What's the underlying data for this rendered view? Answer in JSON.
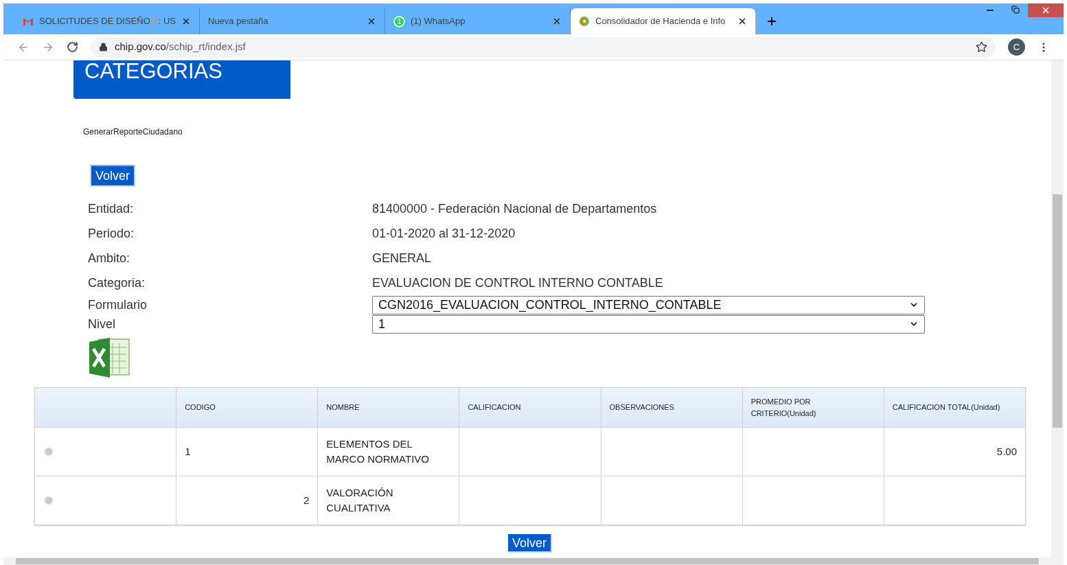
{
  "browser": {
    "tabs": [
      {
        "kind": "mail",
        "title": "SOLICITUDES DE DISEÑO",
        "title_suffix": ": US",
        "selected": false
      },
      {
        "kind": "blank",
        "title": "Nueva pestaña",
        "selected": false
      },
      {
        "kind": "chat",
        "badge": "1",
        "title": "(1) WhatsApp",
        "selected": false
      },
      {
        "kind": "site",
        "title": "Consolidador de Hacienda e Info",
        "selected": true
      }
    ],
    "address": {
      "host": "chip.gov.co",
      "path": "/schip_rt/index.jsf"
    },
    "profile_initial": "C"
  },
  "page": {
    "header": "CATEGORIAS",
    "report_link": "GenerarReporteCiudadano",
    "back_button": "Volver",
    "fields": [
      {
        "kind": "text",
        "label": "Entidad:",
        "value": "81400000 - Federación Nacional de Departamentos"
      },
      {
        "kind": "text",
        "label": "Periodo:",
        "value": "01-01-2020 al 31-12-2020"
      },
      {
        "kind": "text",
        "label": "Ambito:",
        "value": "GENERAL"
      },
      {
        "kind": "text",
        "label": "Categoria:",
        "value": "EVALUACION DE CONTROL INTERNO CONTABLE"
      },
      {
        "kind": "select",
        "label": "Formulario",
        "value": "CGN2016_EVALUACION_CONTROL_INTERNO_CONTABLE"
      },
      {
        "kind": "select",
        "label": "Nivel",
        "value": "1"
      }
    ],
    "table": {
      "columns": [
        "CODIGO",
        "NOMBRE",
        "CALIFICACION",
        "OBSERVACIONES",
        "PROMEDIO POR CRITERIO(Unidad)",
        "CALIFICACION TOTAL(Unidad)"
      ],
      "rows": [
        {
          "expanded": false,
          "codigo": "1",
          "right_aligned": false,
          "nombre": "ELEMENTOS DEL MARCO NORMATIVO",
          "calificacion_total": "5.00"
        },
        {
          "expanded": false,
          "codigo": "2",
          "right_aligned": true,
          "nombre": "VALORACIÓN CUALITATIVA"
        }
      ]
    },
    "bottom_button": "Volver"
  }
}
